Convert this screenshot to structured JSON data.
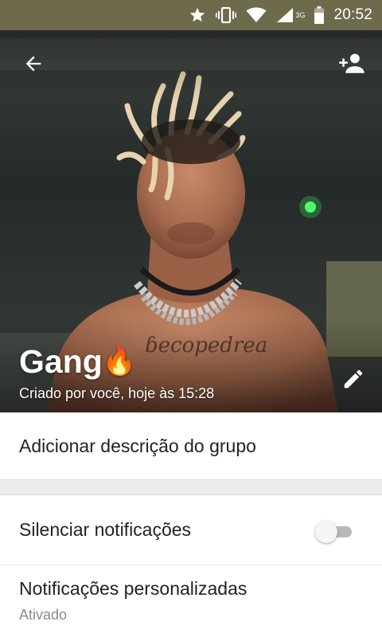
{
  "status_bar": {
    "time": "20:52",
    "network": "3G"
  },
  "group": {
    "name": "Gang",
    "emoji": "🔥",
    "created": "Criado por você, hoje às 15:28"
  },
  "description_row": {
    "label": "Adicionar descrição do grupo"
  },
  "mute_row": {
    "label": "Silenciar notificações",
    "enabled": false
  },
  "custom_notifications_row": {
    "label": "Notificações personalizadas",
    "value": "Ativado"
  },
  "colors": {
    "status_bar": "#6e6a4c",
    "toggle_off": "#b9b9b9"
  }
}
